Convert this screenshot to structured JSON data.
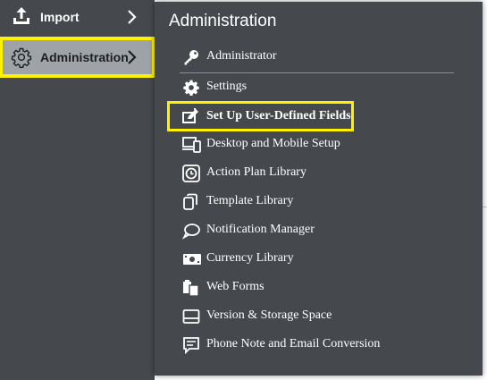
{
  "leftnav": {
    "items": [
      {
        "label": "Import",
        "icon": "upload-icon"
      },
      {
        "label": "Administration",
        "icon": "gear-icon"
      }
    ]
  },
  "flyout": {
    "title": "Administration",
    "items": [
      {
        "label": "Administrator",
        "icon": "key-icon"
      },
      {
        "label": "Settings",
        "icon": "gear-icon"
      },
      {
        "label": "Set Up User-Defined Fields",
        "icon": "edit-icon"
      },
      {
        "label": "Desktop and Mobile Setup",
        "icon": "devices-icon"
      },
      {
        "label": "Action Plan Library",
        "icon": "clock-icon"
      },
      {
        "label": "Template Library",
        "icon": "copy-icon"
      },
      {
        "label": "Notification Manager",
        "icon": "chat-bubble-icon"
      },
      {
        "label": "Currency Library",
        "icon": "banknote-icon"
      },
      {
        "label": "Web Forms",
        "icon": "clipboard-icon"
      },
      {
        "label": "Version & Storage Space",
        "icon": "storage-icon"
      },
      {
        "label": "Phone Note and Email Conversion",
        "icon": "message-icon"
      }
    ]
  },
  "colors": {
    "panel": "#45494d",
    "selected": "#9da3a7",
    "highlight": "#fff200",
    "text": "#ffffff"
  }
}
